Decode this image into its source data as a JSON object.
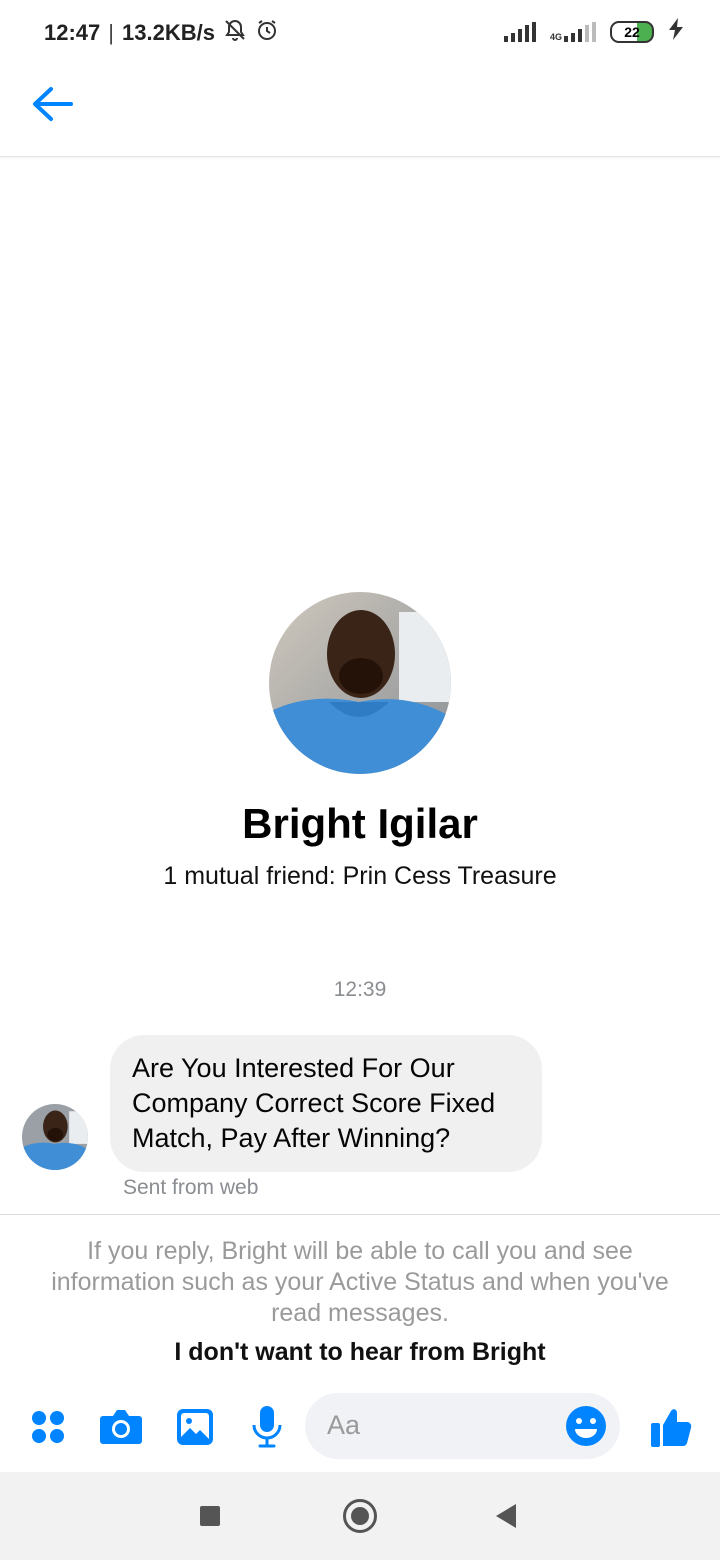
{
  "status_bar": {
    "time": "12:47",
    "separator": "|",
    "speed": "13.2KB/s",
    "network_label": "4G",
    "battery": "22",
    "icons": [
      "bell-off-icon",
      "alarm-icon",
      "signal-icon",
      "signal-4g-icon",
      "battery-icon",
      "charging-icon"
    ]
  },
  "header": {
    "back_icon": "arrow-left-icon"
  },
  "profile": {
    "name": "Bright Igilar",
    "mutual": "1 mutual friend: Prin Cess Treasure"
  },
  "conversation": {
    "timestamp": "12:39",
    "messages": [
      {
        "text": "Are You Interested For Our Company Correct Score Fixed Match, Pay After Winning?",
        "meta": "Sent from web"
      }
    ]
  },
  "request": {
    "notice": "If you reply, Bright will be able to call you and see information such as your Active Status and when you've read messages.",
    "block_label": "I don't want to hear from Bright"
  },
  "composer": {
    "placeholder": "Aa",
    "icons": [
      "apps-icon",
      "camera-icon",
      "gallery-icon",
      "microphone-icon",
      "emoji-icon",
      "thumbs-up-icon"
    ]
  },
  "colors": {
    "accent": "#0084ff",
    "bubble": "#f0f0f0",
    "muted": "#8a8d91"
  }
}
